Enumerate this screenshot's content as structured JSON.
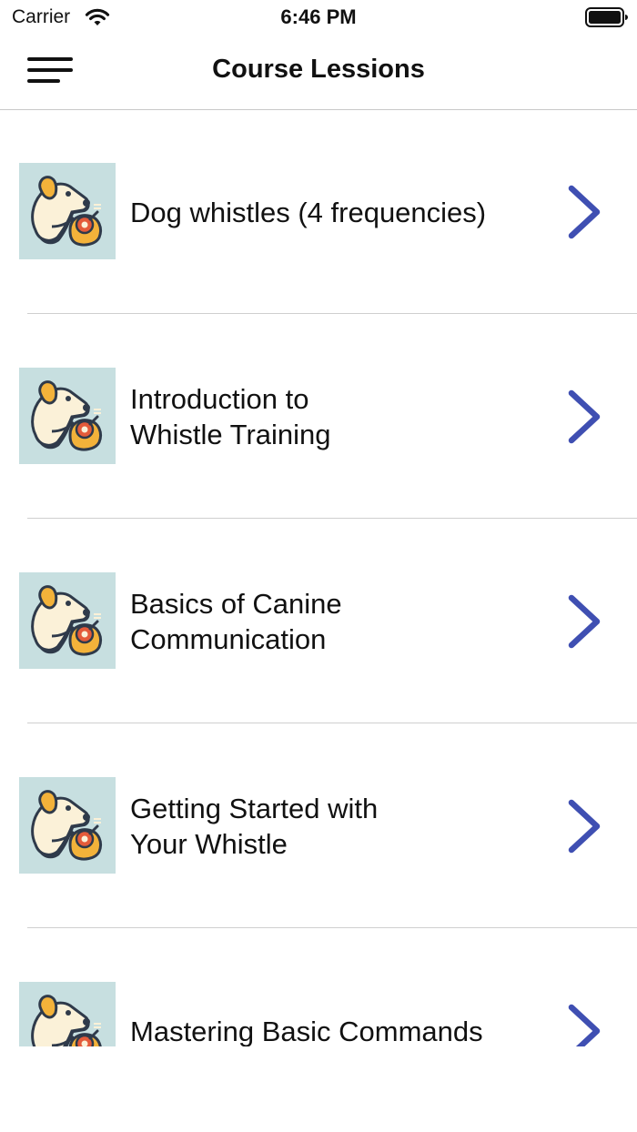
{
  "status_bar": {
    "carrier": "Carrier",
    "time": "6:46 PM",
    "icons": [
      "wifi-icon",
      "battery-icon"
    ]
  },
  "nav": {
    "title": "Course Lessions",
    "menu_icon": "hamburger-menu-icon"
  },
  "lessons": [
    {
      "title": "Dog whistles (4 frequencies)",
      "thumbnail": "dog-whistle-thumbnail",
      "chevron": "chevron-right-icon"
    },
    {
      "title": "Introduction to Whistle Training",
      "thumbnail": "dog-whistle-thumbnail",
      "chevron": "chevron-right-icon"
    },
    {
      "title": "Basics of Canine Communication",
      "thumbnail": "dog-whistle-thumbnail",
      "chevron": "chevron-right-icon"
    },
    {
      "title": "Getting Started with Your Whistle",
      "thumbnail": "dog-whistle-thumbnail",
      "chevron": "chevron-right-icon"
    },
    {
      "title": "Mastering Basic Commands",
      "thumbnail": "dog-whistle-thumbnail",
      "chevron": "chevron-right-icon"
    }
  ],
  "colors": {
    "accent": "#3f4fb2",
    "thumb_bg": "#c7dfe0",
    "divider": "#cfcfcf",
    "text": "#111111"
  }
}
